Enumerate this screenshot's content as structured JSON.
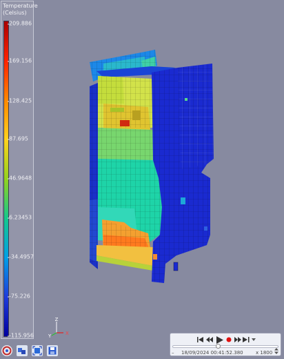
{
  "legend": {
    "title_line1": "Temperature",
    "title_line2": "(Celsius)",
    "colors": [
      "#aa0000",
      "#ff2200",
      "#ff8800",
      "#ffd21e",
      "#94d21e",
      "#16c88c",
      "#00a0e6",
      "#1e3cdc",
      "#0000a0"
    ],
    "ticks": [
      {
        "label": "209.886",
        "value": 209.886
      },
      {
        "label": "169.156",
        "value": 169.156
      },
      {
        "label": "128.425",
        "value": 128.425
      },
      {
        "label": "87.695",
        "value": 87.695
      },
      {
        "label": "46.9648",
        "value": 46.9648
      },
      {
        "label": "6.23453",
        "value": 6.23453
      },
      {
        "label": "-34.4957",
        "value": -34.4957
      },
      {
        "label": "-75.226",
        "value": -75.226
      },
      {
        "label": "-115.956",
        "value": -115.956
      }
    ]
  },
  "axes": {
    "z": "Z",
    "y": "Y",
    "x": "X"
  },
  "toolbar": {
    "buttons": [
      {
        "name": "reset-view-button",
        "icon": "reset-view-icon"
      },
      {
        "name": "view-cube-button",
        "icon": "view-cube-icon"
      },
      {
        "name": "fit-view-button",
        "icon": "fit-view-icon"
      },
      {
        "name": "save-view-button",
        "icon": "save-icon"
      }
    ]
  },
  "player": {
    "datetime": "18/09/2024 00:41:52.380",
    "speed": "x 1800",
    "progress": 0.42,
    "record_color": "#e01010"
  },
  "colors": {
    "background": "#878aa0"
  }
}
